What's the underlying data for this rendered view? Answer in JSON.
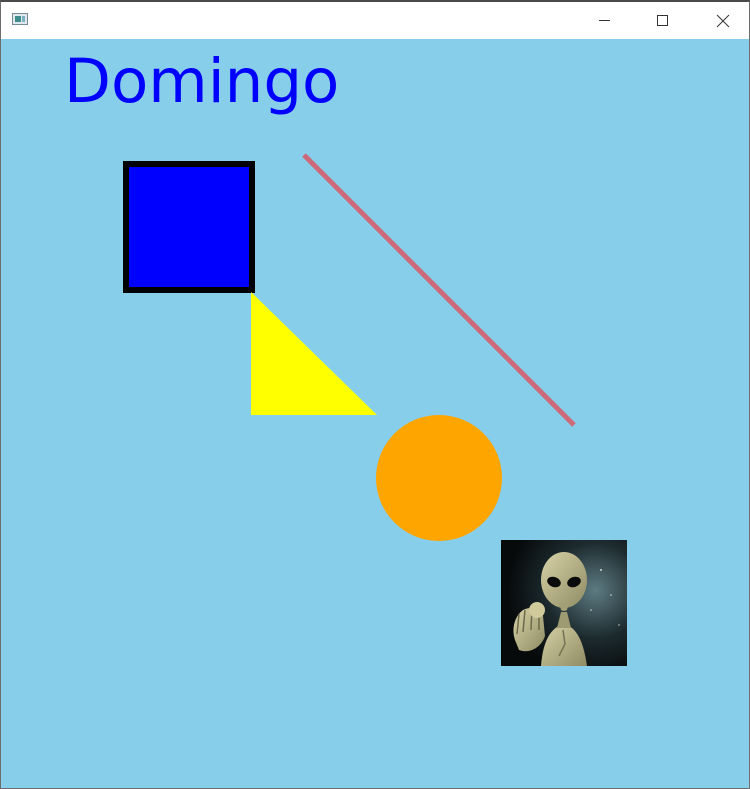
{
  "window": {
    "icon": "application-window-icon",
    "buttons": {
      "minimize_icon": "minimize-icon",
      "maximize_icon": "maximize-icon",
      "close_icon": "close-icon"
    }
  },
  "canvas": {
    "background_color": "#87ceeb",
    "text": "Domingo",
    "text_color": "#0000ff",
    "shapes": [
      {
        "shape": "square",
        "fill": "#0000ff",
        "stroke": "#000000"
      },
      {
        "shape": "triangle",
        "fill": "#ffff00"
      },
      {
        "shape": "line",
        "stroke": "#cd6a7a"
      },
      {
        "shape": "circle",
        "fill": "#ffa500"
      },
      {
        "shape": "image",
        "subject": "alien"
      }
    ]
  }
}
